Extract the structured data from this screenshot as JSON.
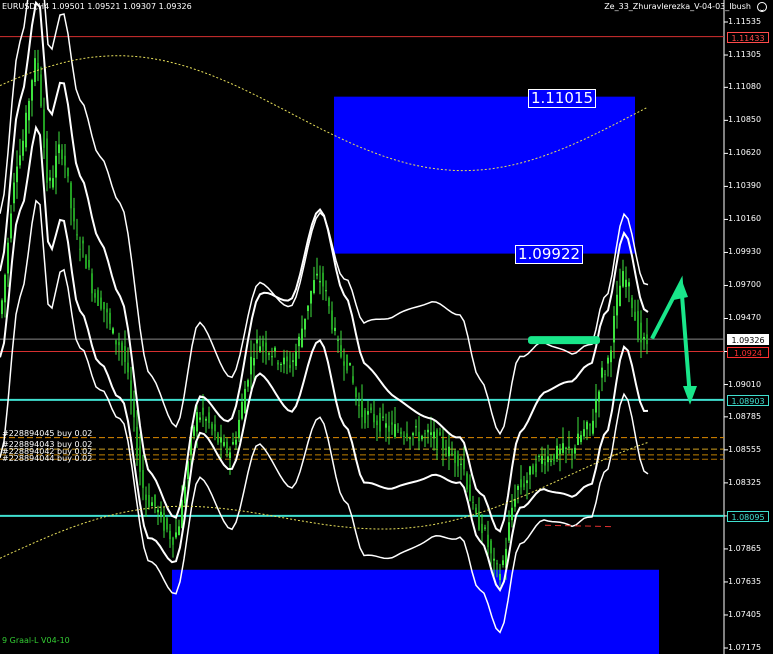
{
  "header": {
    "symbol_line": "EURUSD,H4  1.09501 1.09521 1.09307 1.09326",
    "indicator_name": "Ze_33_Zhuravlerezka_V-04-03_Ibush"
  },
  "subwindow_label": "9 Graal-L V04-10",
  "boxes": {
    "upper_top_label": "1.11015",
    "upper_bottom_label": "1.09922"
  },
  "price_axis": {
    "ticks": [
      "1.11535",
      "1.11305",
      "1.11080",
      "1.10850",
      "1.10620",
      "1.10390",
      "1.10160",
      "1.09930",
      "1.09700",
      "1.09470",
      "1.09240",
      "1.09010",
      "1.08785",
      "1.08555",
      "1.08325",
      "1.08095",
      "1.07865",
      "1.07635",
      "1.07405",
      "1.07175"
    ],
    "tags": [
      {
        "value": "1.11433",
        "color": "#ff4a4a"
      },
      {
        "value": "1.09326",
        "color": "#ffffff"
      },
      {
        "value": "1.0924",
        "color": "#ff3030"
      },
      {
        "value": "1.08903",
        "color": "#40e0d0"
      },
      {
        "value": "1.08095",
        "color": "#40e0d0"
      }
    ]
  },
  "orders": [
    "#228894045 buy 0.02",
    "#228894043 buy 0.02",
    "#228894042 buy 0.02",
    "#228894044 buy 0.02"
  ],
  "colors": {
    "candles": "#3ee23e",
    "bands": "#ffffff",
    "box": "#0000ff",
    "level_red": "#d63030",
    "level_cyan": "#40e0d0",
    "arrow": "#19e68a"
  }
}
